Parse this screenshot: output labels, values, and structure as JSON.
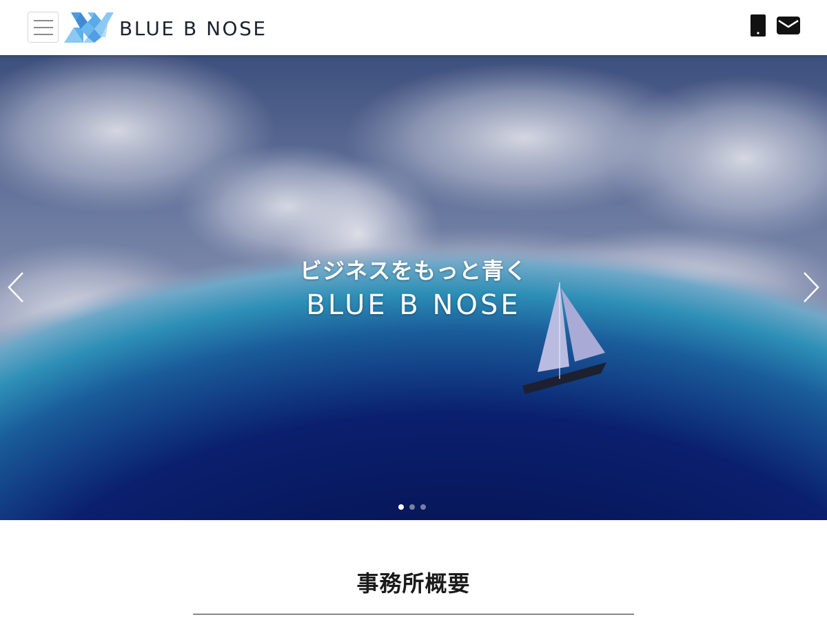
{
  "header": {
    "brand_name": "BLUE B NOSE",
    "icons": {
      "menu": "hamburger-menu-icon",
      "phone": "smartphone-icon",
      "mail": "envelope-icon"
    }
  },
  "hero": {
    "tagline": "ビジネスをもっと青く",
    "title": "BLUE B NOSE",
    "slides_total": 3,
    "active_slide": 1,
    "prev_icon": "chevron-left-icon",
    "next_icon": "chevron-right-icon"
  },
  "section": {
    "title": "事務所概要"
  },
  "colors": {
    "brand_blue": "#4a9be0",
    "brand_light_blue": "#8cc8f2",
    "text_dark": "#1d2230",
    "hero_sky": "#5b6b95",
    "hero_ocean": "#0e2a7a"
  }
}
